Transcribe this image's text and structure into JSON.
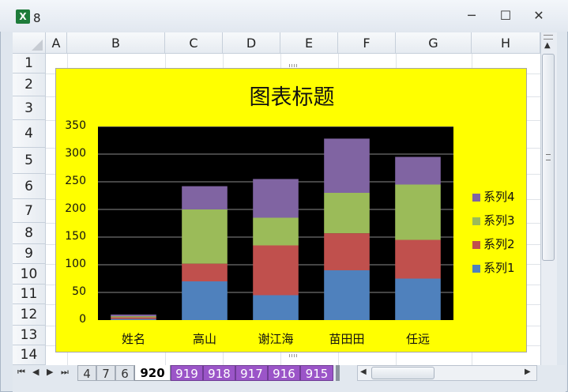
{
  "window": {
    "title": "8",
    "minimize_glyph": "─",
    "maximize_glyph": "☐",
    "close_glyph": "✕",
    "app_icon_glyph": "X"
  },
  "sheet": {
    "columns": [
      "A",
      "B",
      "C",
      "D",
      "E",
      "F",
      "G",
      "H"
    ],
    "rows": [
      "1",
      "2",
      "3",
      "4",
      "5",
      "6",
      "7",
      "8",
      "9",
      "10",
      "11",
      "12",
      "13",
      "14"
    ]
  },
  "tabs": {
    "nav": [
      "⏮",
      "◀",
      "▶",
      "⏭"
    ],
    "items": [
      {
        "label": "4",
        "style": "gray"
      },
      {
        "label": "7",
        "style": "gray"
      },
      {
        "label": "6",
        "style": "gray"
      },
      {
        "label": "920",
        "style": "active"
      },
      {
        "label": "919",
        "style": "purple"
      },
      {
        "label": "918",
        "style": "purple"
      },
      {
        "label": "917",
        "style": "purple"
      },
      {
        "label": "916",
        "style": "purple"
      },
      {
        "label": "915",
        "style": "purple"
      }
    ]
  },
  "chart_data": {
    "type": "bar",
    "stacked": true,
    "title": "图表标题",
    "categories": [
      "姓名",
      "高山",
      "谢江海",
      "苗田田",
      "任远"
    ],
    "ylim": [
      0,
      350
    ],
    "yticks": [
      0,
      50,
      100,
      150,
      200,
      250,
      300,
      350
    ],
    "grid": true,
    "legend_position": "right",
    "background": "#ffff00",
    "plot_background": "#000000",
    "series": [
      {
        "name": "系列1",
        "color": "#4f81bd",
        "values": [
          2,
          70,
          45,
          90,
          75
        ]
      },
      {
        "name": "系列2",
        "color": "#c0504d",
        "values": [
          3,
          32,
          90,
          67,
          70
        ]
      },
      {
        "name": "系列3",
        "color": "#9bbb59",
        "values": [
          2,
          98,
          50,
          73,
          100
        ]
      },
      {
        "name": "系列4",
        "color": "#8064a2",
        "values": [
          3,
          42,
          70,
          98,
          50
        ]
      }
    ]
  }
}
